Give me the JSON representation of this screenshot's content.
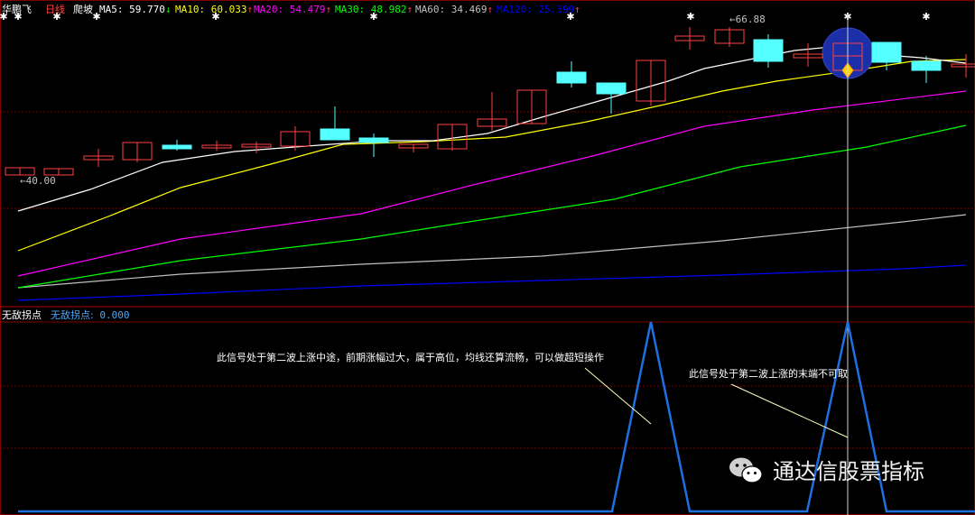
{
  "header": {
    "stock_name": "华鹏飞",
    "period": "日线",
    "formula": "爬坡",
    "ma": [
      {
        "label": "MA5:",
        "value": "59.770",
        "arrow": "↓",
        "color": "#ffffff"
      },
      {
        "label": "MA10:",
        "value": "60.033",
        "arrow": "↑",
        "color": "#ffff00"
      },
      {
        "label": "MA20:",
        "value": "54.479",
        "arrow": "↑",
        "color": "#ff00ff"
      },
      {
        "label": "MA30:",
        "value": "48.982",
        "arrow": "↑",
        "color": "#00ff00"
      },
      {
        "label": "MA60:",
        "value": "34.469",
        "arrow": "↑",
        "color": "#c0c0c0"
      },
      {
        "label": "MA120:",
        "value": "25.399",
        "arrow": "↑",
        "color": "#0000ff"
      }
    ]
  },
  "price_marks": {
    "high_label": "66.88",
    "low_label": "40.00",
    "arrow_glyph": "←"
  },
  "indicator": {
    "name": "无敌拐点",
    "value_label": "无敌拐点:",
    "value": "0.000"
  },
  "annotations": [
    "此信号处于第二波上涨中途，前期涨幅过大，属于高位，均线还算流畅，可以做超短操作",
    "此信号处于第二波上涨的末端不可取"
  ],
  "watermark": "通达信股票指标",
  "colors": {
    "up": "#ff4040",
    "down": "#54ffff",
    "grid": "#800000",
    "ma5": "#ffffff",
    "ma10": "#ffff00",
    "ma20": "#ff00ff",
    "ma30": "#00ff00",
    "ma60": "#c0c0c0",
    "ma120": "#0000ff",
    "signal": "#1e6fe0",
    "circle": "#1a2fa8"
  }
}
